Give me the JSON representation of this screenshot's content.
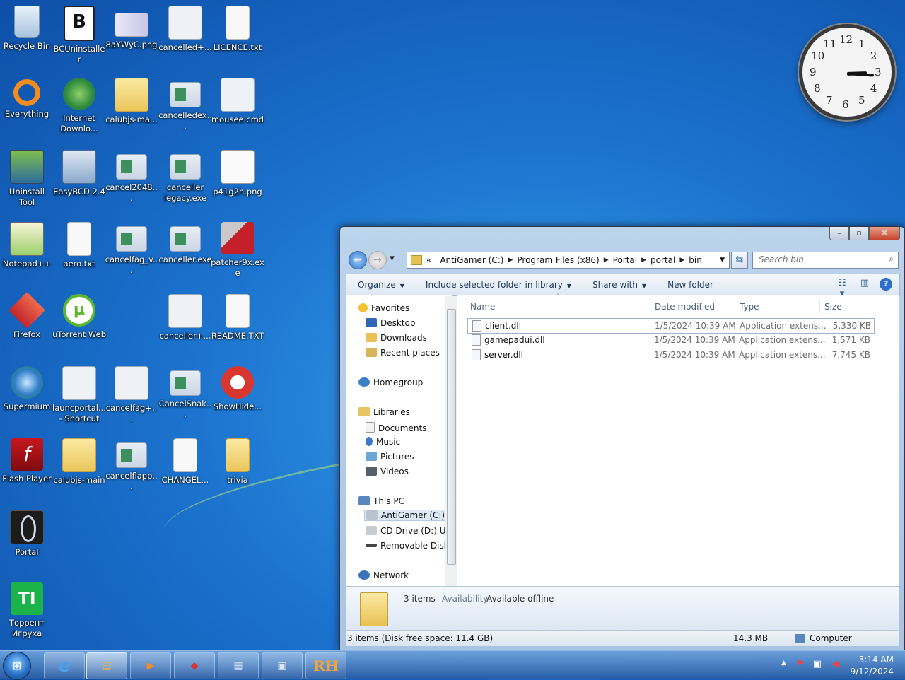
{
  "desktop": {
    "icons": [
      {
        "label": "Recycle Bin"
      },
      {
        "label": "BCUninstaller"
      },
      {
        "label": "8aYWyC.png"
      },
      {
        "label": "cancelled+..."
      },
      {
        "label": "LICENCE.txt"
      },
      {
        "label": "Everything"
      },
      {
        "label": "Internet Downlo..."
      },
      {
        "label": "calubjs-ma..."
      },
      {
        "label": "cancelledex..."
      },
      {
        "label": "mousee.cmd"
      },
      {
        "label": "Uninstall Tool"
      },
      {
        "label": "EasyBCD 2.4"
      },
      {
        "label": "cancel2048..."
      },
      {
        "label": "canceller legacy.exe"
      },
      {
        "label": "p41g2h.png"
      },
      {
        "label": "Notepad++"
      },
      {
        "label": "aero.txt"
      },
      {
        "label": "cancelfag_v..."
      },
      {
        "label": "canceller.exe"
      },
      {
        "label": "patcher9x.exe"
      },
      {
        "label": "Firefox"
      },
      {
        "label": "uTorrent Web"
      },
      {
        "label": "canceller+..."
      },
      {
        "label": "README.TXT"
      },
      {
        "label": "Supermium"
      },
      {
        "label": "launcportal... - Shortcut"
      },
      {
        "label": "cancelfag+..."
      },
      {
        "label": "CancelSnak..."
      },
      {
        "label": "ShowHide..."
      },
      {
        "label": "Flash Player"
      },
      {
        "label": "calubjs-main"
      },
      {
        "label": "cancelflapp..."
      },
      {
        "label": "CHANGEL..."
      },
      {
        "label": "trivia"
      },
      {
        "label": "Portal"
      },
      {
        "label": "Торрент Игруха"
      }
    ]
  },
  "explorer": {
    "address": {
      "prefix": "«",
      "segments": [
        "AntiGamer (C:)",
        "Program Files (x86)",
        "Portal",
        "portal",
        "bin"
      ]
    },
    "search_placeholder": "Search bin",
    "toolbar": {
      "organize": "Organize",
      "include": "Include selected folder in library",
      "share": "Share with",
      "new_folder": "New folder"
    },
    "nav": {
      "favorites": "Favorites",
      "desktop": "Desktop",
      "downloads": "Downloads",
      "recent": "Recent places",
      "homegroup": "Homegroup",
      "libraries": "Libraries",
      "documents": "Documents",
      "music": "Music",
      "pictures": "Pictures",
      "videos": "Videos",
      "thispc": "This PC",
      "antigamer": "AntiGamer (C:)",
      "cddrive": "CD Drive (D:) Ubu",
      "removable": "Removable Disk (",
      "network": "Network"
    },
    "columns": {
      "name": "Name",
      "date": "Date modified",
      "type": "Type",
      "size": "Size"
    },
    "files": [
      {
        "name": "client.dll",
        "date": "1/5/2024 10:39 AM",
        "type": "Application extens...",
        "size": "5,330 KB"
      },
      {
        "name": "gamepadui.dll",
        "date": "1/5/2024 10:39 AM",
        "type": "Application extens...",
        "size": "1,571 KB"
      },
      {
        "name": "server.dll",
        "date": "1/5/2024 10:39 AM",
        "type": "Application extens...",
        "size": "7,745 KB"
      }
    ],
    "details": {
      "count": "3 items",
      "availability_label": "Availability:",
      "availability_value": "Available offline"
    },
    "status": {
      "items": "3 items (Disk free space: 11.4 GB)",
      "size": "14.3 MB",
      "location": "Computer"
    }
  },
  "clock": {
    "numbers": [
      "12",
      "1",
      "2",
      "3",
      "4",
      "5",
      "6",
      "7",
      "8",
      "9",
      "10",
      "11"
    ]
  },
  "taskbar": {
    "time": "3:14 AM",
    "date": "9/12/2024",
    "apps": [
      {
        "name": "internet-explorer",
        "glyph": "e"
      },
      {
        "name": "file-explorer",
        "glyph": "▤"
      },
      {
        "name": "media-player",
        "glyph": "▶"
      },
      {
        "name": "firefox",
        "glyph": "◆"
      },
      {
        "name": "control-panel",
        "glyph": "▦"
      },
      {
        "name": "computer",
        "glyph": "▣"
      },
      {
        "name": "resource-hacker",
        "glyph": "RH"
      }
    ]
  }
}
